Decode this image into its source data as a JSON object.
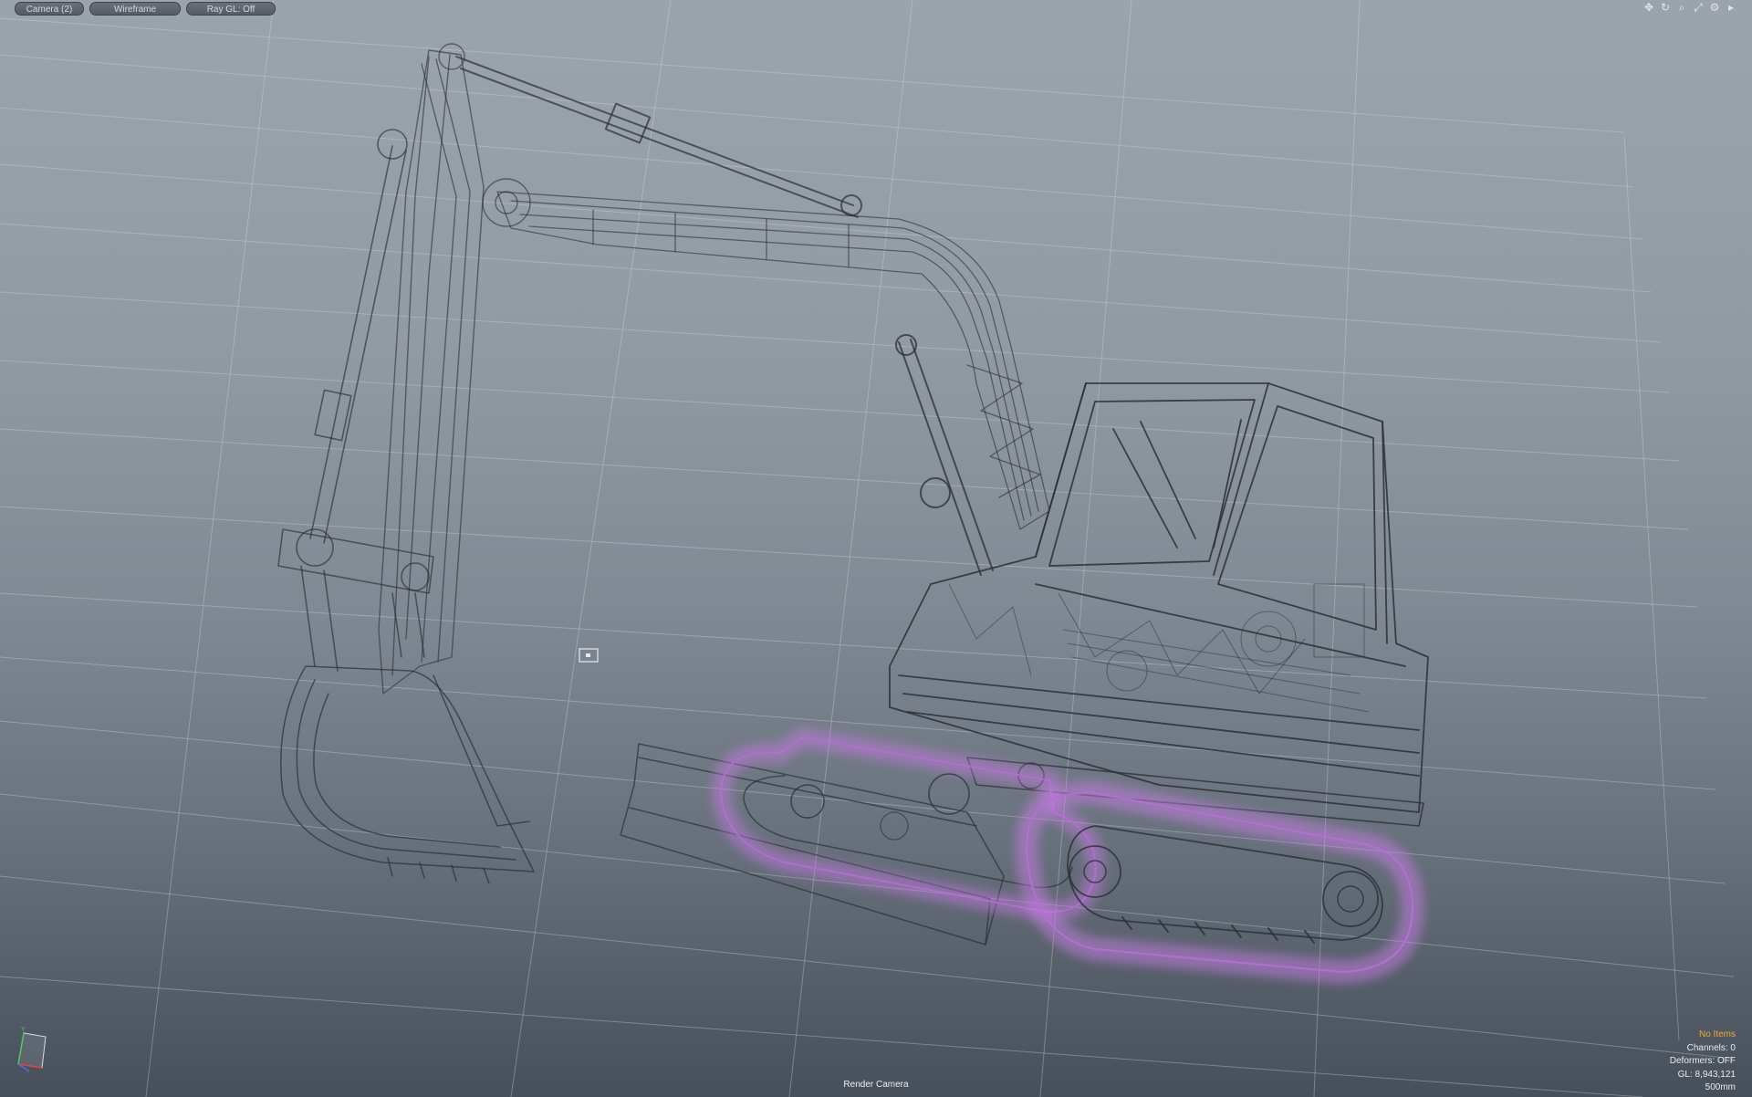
{
  "toolbar": {
    "camera_label": "Camera (2)",
    "shading_label": "Wireframe",
    "raygl_label": "Ray GL: Off"
  },
  "view_tools": [
    {
      "icon": "move-view-icon",
      "glyph": "✥"
    },
    {
      "icon": "rotate-view-icon",
      "glyph": "↻"
    },
    {
      "icon": "zoom-view-icon",
      "glyph": "⌕"
    },
    {
      "icon": "maximize-view-icon",
      "glyph": "⤢"
    },
    {
      "icon": "settings-gear-icon",
      "glyph": "⚙"
    },
    {
      "icon": "expand-arrow-icon",
      "glyph": "▸"
    }
  ],
  "info": {
    "items": "No Items",
    "channels": "Channels: 0",
    "deformers": "Deformers: OFF",
    "gl": "GL: 8,943,121",
    "scale": "500mm"
  },
  "camera_name": "Render Camera",
  "colors": {
    "items_text": "#f0a73a",
    "selection_highlight": "#c77be6",
    "wire": "#2c3038"
  }
}
